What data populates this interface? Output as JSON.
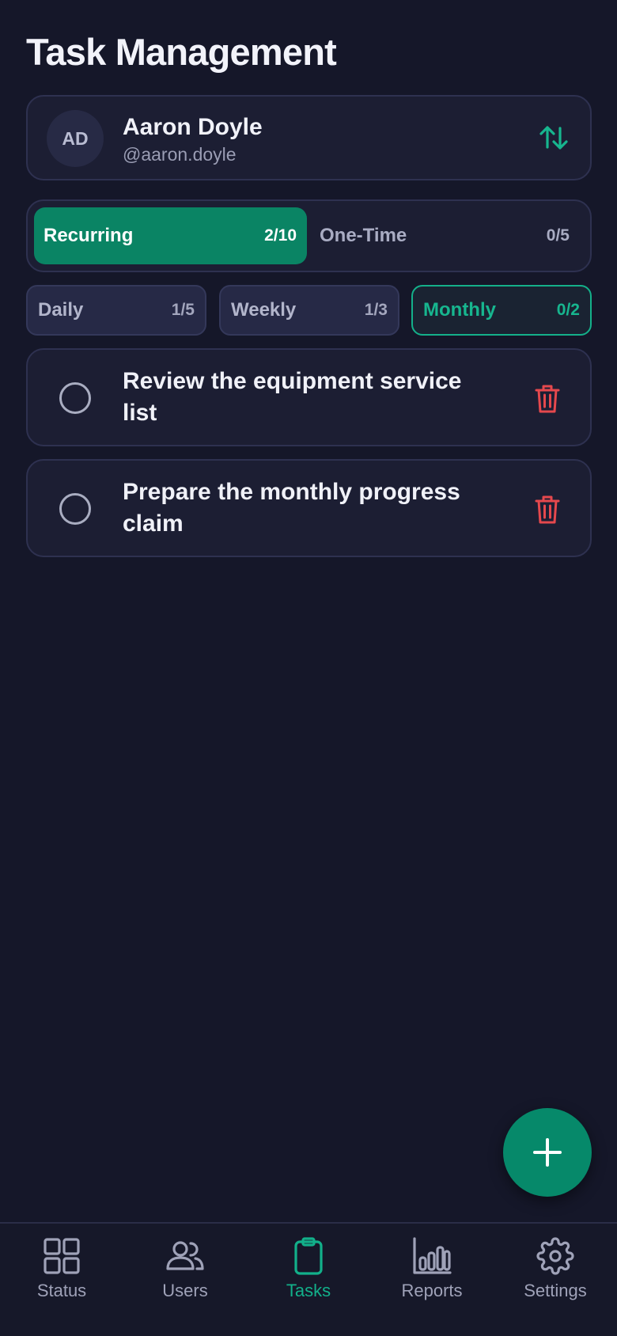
{
  "header": {
    "title": "Task Management"
  },
  "user": {
    "initials": "AD",
    "name": "Aaron Doyle",
    "handle": "@aaron.doyle",
    "switch_icon": "swap-vertical-icon"
  },
  "task_type_tabs": [
    {
      "label": "Recurring",
      "count": "2/10",
      "active": true
    },
    {
      "label": "One-Time",
      "count": "0/5",
      "active": false
    }
  ],
  "frequency_filters": [
    {
      "label": "Daily",
      "count": "1/5",
      "active": false
    },
    {
      "label": "Weekly",
      "count": "1/3",
      "active": false
    },
    {
      "label": "Monthly",
      "count": "0/2",
      "active": true
    }
  ],
  "tasks": [
    {
      "text": "Review the equipment service list",
      "completed": false
    },
    {
      "text": "Prepare the monthly progress claim",
      "completed": false
    }
  ],
  "fab": {
    "icon": "plus-icon"
  },
  "bottom_nav": [
    {
      "label": "Status",
      "icon": "grid-icon",
      "active": false
    },
    {
      "label": "Users",
      "icon": "users-icon",
      "active": false
    },
    {
      "label": "Tasks",
      "icon": "clipboard-icon",
      "active": true
    },
    {
      "label": "Reports",
      "icon": "bar-chart-icon",
      "active": false
    },
    {
      "label": "Settings",
      "icon": "gear-icon",
      "active": false
    }
  ],
  "colors": {
    "background": "#151729",
    "card": "#1c1e33",
    "accent": "#0a8464",
    "accent_text": "#17b68f",
    "danger": "#e5484d"
  }
}
